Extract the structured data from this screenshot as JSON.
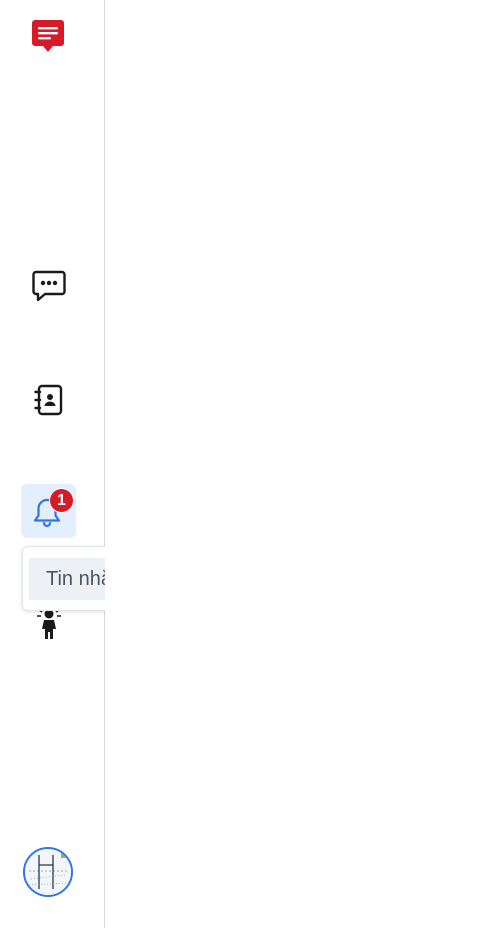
{
  "sidebar": {
    "logo_icon": "red-chat-logo-icon",
    "items": [
      {
        "icon": "chat-bubble-icon"
      },
      {
        "icon": "contacts-book-icon"
      },
      {
        "icon": "bell-icon",
        "badge": "1"
      },
      {
        "icon": "person-idea-icon"
      }
    ]
  },
  "notification_tooltip": {
    "text": "Tin nhắn mới từ Nguyễn Trí Anh"
  },
  "colors": {
    "brand": "#d61a28",
    "active_bg": "#e3efff",
    "accent": "#2f74e8"
  }
}
